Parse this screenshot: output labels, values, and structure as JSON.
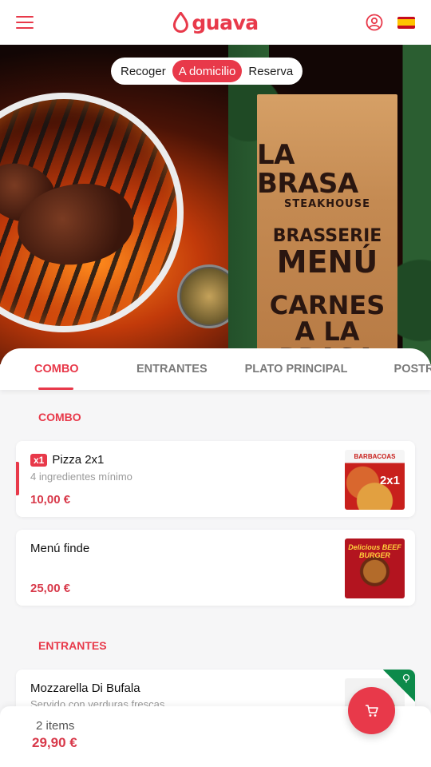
{
  "brand": {
    "name": "guava"
  },
  "colors": {
    "accent": "#e8394a",
    "corner_tag": "#0c8a4a"
  },
  "icons": {
    "menu": "hamburger-icon",
    "user": "user-circle-icon",
    "language": "spain-flag-icon",
    "cart": "cart-icon",
    "tag": "leaf-tag-icon"
  },
  "order_modes": {
    "items": [
      "Recoger",
      "A domicilio",
      "Reserva"
    ],
    "selected": "A domicilio"
  },
  "hero": {
    "line1": "LA BRASA",
    "line2": "STEAKHOUSE",
    "line3": "BRASSERIE",
    "line4": "MENÚ",
    "line5": "CARNES",
    "line6": "A LA BRASA"
  },
  "categories": {
    "items": [
      "COMBO",
      "ENTRANTES",
      "PLATO PRINCIPAL",
      "POSTRE"
    ],
    "selected": "COMBO"
  },
  "sections": [
    {
      "title": "COMBO",
      "products": [
        {
          "quantity_badge": "x1",
          "name": "Pizza 2x1",
          "description": "4 ingredientes mínimo",
          "price": "10,00 €",
          "image_text_top": "BARBACOAS",
          "image_text_badge": "2x1"
        },
        {
          "name": "Menú finde",
          "description": "",
          "price": "25,00 €",
          "image_text_top": "Delicious BEEF BURGER"
        }
      ]
    },
    {
      "title": "ENTRANTES",
      "products": [
        {
          "name": "Mozzarella Di Bufala",
          "description": "Servido con verduras frescas"
        }
      ]
    }
  ],
  "footer": {
    "items_count": "2 items",
    "total": "29,90 €"
  }
}
